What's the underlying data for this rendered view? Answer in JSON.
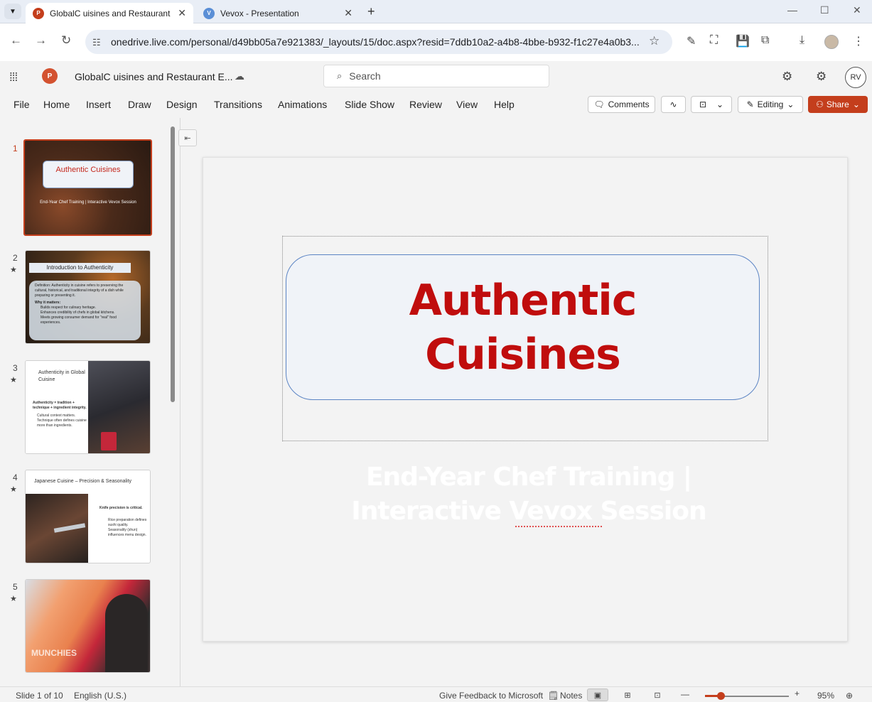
{
  "browser": {
    "tabs": [
      {
        "title": "GlobalC uisines and Restaurant",
        "active": true,
        "favicon": "powerpoint-icon"
      },
      {
        "title": "Vevox - Presentation",
        "active": false,
        "favicon": "vevox-icon"
      }
    ],
    "url": "onedrive.live.com/personal/d49bb05a7e921383/_layouts/15/doc.aspx?resid=7ddb10a2-a4b8-4bbe-b932-f1c27e4a0b3..."
  },
  "office": {
    "doc_title": "GlobalC uisines and Restaurant E...",
    "search_placeholder": "Search",
    "avatar_initials": "RV",
    "accent": "#c43e1c"
  },
  "ribbon": {
    "menu": [
      "File",
      "Home",
      "Insert",
      "Draw",
      "Design",
      "Transitions",
      "Animations",
      "Slide Show",
      "Review",
      "View",
      "Help"
    ],
    "comments_label": "Comments",
    "editing_label": "Editing",
    "share_label": "Share"
  },
  "thumbnails": [
    {
      "num": "1",
      "title": "Authentic Cuisines",
      "subtitle": "End-Year Chef Training | Interactive Vevox Session"
    },
    {
      "num": "2",
      "title": "Introduction to Authenticity",
      "body": [
        "Definition: Authenticity in cuisine refers to preserving the cultural, historical, and traditional integrity of a dish while preparing or presenting it.",
        "Why it matters:",
        "Builds respect for culinary heritage.",
        "Enhances credibility of chefs in global kitchens.",
        "Meets growing consumer demand for \"real\" food experiences."
      ]
    },
    {
      "num": "3",
      "title": "Authenticity in Global Cuisine",
      "body": [
        "Authenticity = tradition + technique + ingredient integrity.",
        "Cultural context matters.",
        "Technique often defines cuisine more than ingredients."
      ]
    },
    {
      "num": "4",
      "title": "Japanese Cuisine – Precision & Seasonality",
      "body": [
        "Knife precision is critical.",
        "Rice preparation defines sushi quality.",
        "Seasonality (shun) influences menu design."
      ]
    },
    {
      "num": "5",
      "brand": "MUNCHIES"
    }
  ],
  "slide": {
    "title_lines": [
      "Authentic",
      "Cuisines"
    ],
    "subtitle_lines": [
      "End-Year Chef Training |",
      "Interactive Vevox Session"
    ],
    "title_color": "#c00d0d"
  },
  "status": {
    "slide_counter": "Slide 1 of 10",
    "language": "English (U.S.)",
    "feedback": "Give Feedback to Microsoft",
    "notes": "Notes",
    "zoom": "95%"
  }
}
